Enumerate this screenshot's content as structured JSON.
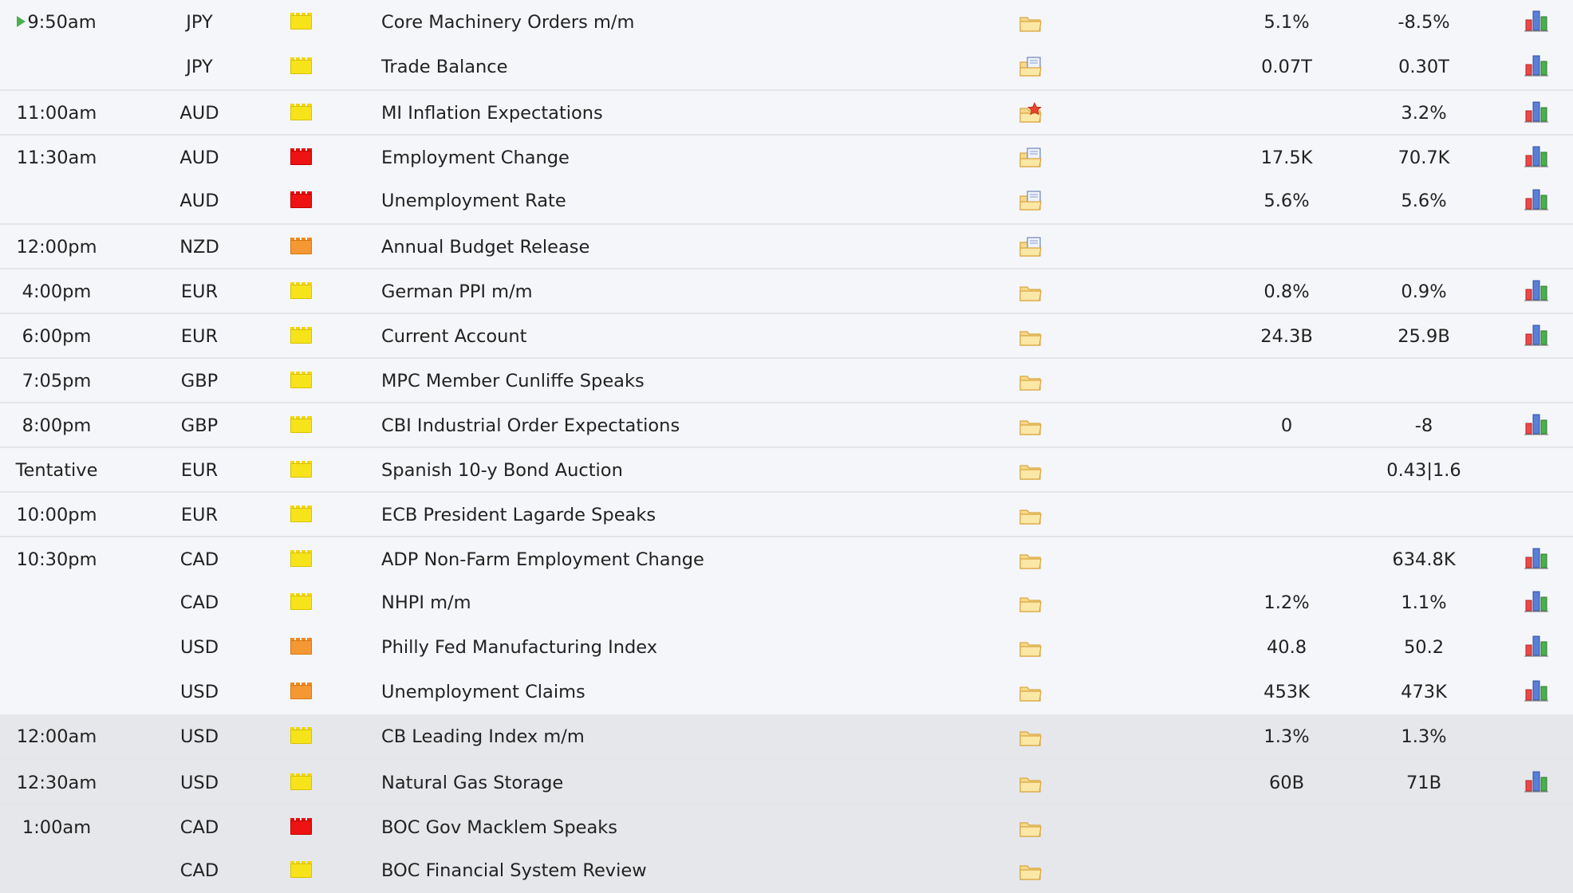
{
  "calendar": {
    "rows": [
      {
        "time": "9:50am",
        "currency": "JPY",
        "impact": "low",
        "event": "Core Machinery Orders m/m",
        "folder": "plain",
        "forecast": "5.1%",
        "previous": "-8.5%",
        "graph": true,
        "current": true,
        "sep": false,
        "past": false
      },
      {
        "time": "",
        "currency": "JPY",
        "impact": "low",
        "event": "Trade Balance",
        "folder": "doc",
        "forecast": "0.07T",
        "previous": "0.30T",
        "graph": true,
        "sep": false,
        "past": false
      },
      {
        "time": "11:00am",
        "currency": "AUD",
        "impact": "low",
        "event": "MI Inflation Expectations",
        "folder": "star",
        "forecast": "",
        "previous": "3.2%",
        "graph": true,
        "sep": true,
        "past": false
      },
      {
        "time": "11:30am",
        "currency": "AUD",
        "impact": "high",
        "event": "Employment Change",
        "folder": "doc",
        "forecast": "17.5K",
        "previous": "70.7K",
        "graph": true,
        "sep": true,
        "past": false
      },
      {
        "time": "",
        "currency": "AUD",
        "impact": "high",
        "event": "Unemployment Rate",
        "folder": "doc",
        "forecast": "5.6%",
        "previous": "5.6%",
        "graph": true,
        "sep": false,
        "past": false
      },
      {
        "time": "12:00pm",
        "currency": "NZD",
        "impact": "medium",
        "event": "Annual Budget Release",
        "folder": "doc",
        "forecast": "",
        "previous": "",
        "graph": false,
        "sep": true,
        "past": false
      },
      {
        "time": "4:00pm",
        "currency": "EUR",
        "impact": "low",
        "event": "German PPI m/m",
        "folder": "plain",
        "forecast": "0.8%",
        "previous": "0.9%",
        "graph": true,
        "sep": true,
        "past": false
      },
      {
        "time": "6:00pm",
        "currency": "EUR",
        "impact": "low",
        "event": "Current Account",
        "folder": "plain",
        "forecast": "24.3B",
        "previous": "25.9B",
        "graph": true,
        "sep": true,
        "past": false
      },
      {
        "time": "7:05pm",
        "currency": "GBP",
        "impact": "low",
        "event": "MPC Member Cunliffe Speaks",
        "folder": "plain",
        "forecast": "",
        "previous": "",
        "graph": false,
        "sep": true,
        "past": false
      },
      {
        "time": "8:00pm",
        "currency": "GBP",
        "impact": "low",
        "event": "CBI Industrial Order Expectations",
        "folder": "plain",
        "forecast": "0",
        "previous": "-8",
        "graph": true,
        "sep": true,
        "past": false
      },
      {
        "time": "Tentative",
        "currency": "EUR",
        "impact": "low",
        "event": "Spanish 10-y Bond Auction",
        "folder": "plain",
        "forecast": "",
        "previous": "0.43|1.6",
        "graph": false,
        "sep": true,
        "past": false
      },
      {
        "time": "10:00pm",
        "currency": "EUR",
        "impact": "low",
        "event": "ECB President Lagarde Speaks",
        "folder": "plain",
        "forecast": "",
        "previous": "",
        "graph": false,
        "sep": true,
        "past": false
      },
      {
        "time": "10:30pm",
        "currency": "CAD",
        "impact": "low",
        "event": "ADP Non-Farm Employment Change",
        "folder": "plain",
        "forecast": "",
        "previous": "634.8K",
        "graph": true,
        "sep": true,
        "past": false
      },
      {
        "time": "",
        "currency": "CAD",
        "impact": "low",
        "event": "NHPI m/m",
        "folder": "plain",
        "forecast": "1.2%",
        "previous": "1.1%",
        "graph": true,
        "sep": false,
        "past": false
      },
      {
        "time": "",
        "currency": "USD",
        "impact": "medium",
        "event": "Philly Fed Manufacturing Index",
        "folder": "plain",
        "forecast": "40.8",
        "previous": "50.2",
        "graph": true,
        "sep": false,
        "past": false
      },
      {
        "time": "",
        "currency": "USD",
        "impact": "medium",
        "event": "Unemployment Claims",
        "folder": "plain",
        "forecast": "453K",
        "previous": "473K",
        "graph": true,
        "sep": false,
        "past": false
      },
      {
        "time": "12:00am",
        "currency": "USD",
        "impact": "low",
        "event": "CB Leading Index m/m",
        "folder": "plain",
        "forecast": "1.3%",
        "previous": "1.3%",
        "graph": false,
        "sep": false,
        "past": true
      },
      {
        "time": "12:30am",
        "currency": "USD",
        "impact": "low",
        "event": "Natural Gas Storage",
        "folder": "plain",
        "forecast": "60B",
        "previous": "71B",
        "graph": true,
        "sep": true,
        "past": true
      },
      {
        "time": "1:00am",
        "currency": "CAD",
        "impact": "high",
        "event": "BOC Gov Macklem Speaks",
        "folder": "plain",
        "forecast": "",
        "previous": "",
        "graph": false,
        "sep": true,
        "past": true
      },
      {
        "time": "",
        "currency": "CAD",
        "impact": "low",
        "event": "BOC Financial System Review",
        "folder": "plain",
        "forecast": "",
        "previous": "",
        "graph": false,
        "sep": false,
        "past": true
      }
    ]
  }
}
